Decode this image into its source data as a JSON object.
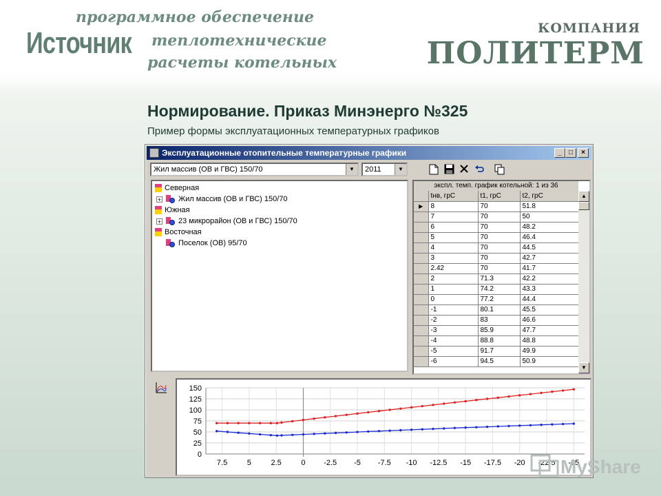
{
  "header": {
    "logo": "Источник",
    "tagline_1": "программное обеспечение",
    "tagline_2": "теплотехнические",
    "tagline_3": "расчеты котельных",
    "company_label": "КОМПАНИЯ",
    "company_name": "ПОЛИТЕРМ"
  },
  "slide": {
    "title": "Нормирование. Приказ Минэнерго №325",
    "subtitle": "Пример формы эксплуатационных температурных графиков"
  },
  "window": {
    "title": "Эксплуатационные отопительные температурные графики",
    "combo_schedule": "Жил массив (ОВ и ГВС) 150/70",
    "combo_year": "2011",
    "toolbar_icons": [
      "new-icon",
      "save-icon",
      "delete-icon",
      "undo-icon",
      "copy-icon"
    ]
  },
  "tree": {
    "nodes": [
      {
        "label": "Северная",
        "kind": "group",
        "level": 0
      },
      {
        "label": "Жил массив (ОВ и ГВС) 150/70",
        "kind": "object",
        "level": 1,
        "expandable": true
      },
      {
        "label": "Южная",
        "kind": "group",
        "level": 0
      },
      {
        "label": "23 микрорайон (ОВ и ГВС) 150/70",
        "kind": "object",
        "level": 1,
        "expandable": true
      },
      {
        "label": "Восточная",
        "kind": "group",
        "level": 0
      },
      {
        "label": "Поселок (ОВ) 95/70",
        "kind": "object",
        "level": 1,
        "expandable": false
      }
    ]
  },
  "grid": {
    "caption": "экспл. темп. график котельной: 1 из 36",
    "columns": [
      "tнв, грС",
      "t1, грС",
      "t2, грС"
    ],
    "rows": [
      [
        "8",
        "70",
        "51.8"
      ],
      [
        "7",
        "70",
        "50"
      ],
      [
        "6",
        "70",
        "48.2"
      ],
      [
        "5",
        "70",
        "46.4"
      ],
      [
        "4",
        "70",
        "44.5"
      ],
      [
        "3",
        "70",
        "42.7"
      ],
      [
        "2.42",
        "70",
        "41.7"
      ],
      [
        "2",
        "71.3",
        "42.2"
      ],
      [
        "1",
        "74.2",
        "43.3"
      ],
      [
        "0",
        "77.2",
        "44.4"
      ],
      [
        "-1",
        "80.1",
        "45.5"
      ],
      [
        "-2",
        "83",
        "46.6"
      ],
      [
        "-3",
        "85.9",
        "47.7"
      ],
      [
        "-4",
        "88.8",
        "48.8"
      ],
      [
        "-5",
        "91.7",
        "49.9"
      ],
      [
        "-6",
        "94.5",
        "50.9"
      ]
    ]
  },
  "chart_data": {
    "type": "line",
    "xlim": [
      9,
      -26
    ],
    "ylim": [
      0,
      150
    ],
    "x_ticks": [
      "7.5",
      "5",
      "2.5",
      "0",
      "-2.5",
      "-5",
      "-7.5",
      "-10",
      "-12.5",
      "-15",
      "-17.5",
      "-20",
      "-22.5",
      "-25"
    ],
    "y_ticks": [
      "150",
      "125",
      "100",
      "75",
      "50",
      "25",
      "0"
    ],
    "grid": true,
    "colors": {
      "t1": "#e02020",
      "t2": "#1a2ad0",
      "cursor": "#808080"
    },
    "cursor_x": 0,
    "x": [
      8,
      7,
      6,
      5,
      4,
      3,
      2.42,
      2,
      1,
      0,
      -1,
      -2,
      -3,
      -4,
      -5,
      -6,
      -7,
      -8,
      -9,
      -10,
      -11,
      -12,
      -13,
      -14,
      -15,
      -16,
      -17,
      -18,
      -19,
      -20,
      -21,
      -22,
      -23,
      -24,
      -25
    ],
    "series": [
      {
        "key": "t1",
        "values": [
          70,
          70,
          70,
          70,
          70,
          70,
          70,
          71.3,
          74.2,
          77.2,
          80.1,
          83,
          85.9,
          88.8,
          91.7,
          94.5,
          97.3,
          100.1,
          102.9,
          105.7,
          108.5,
          111.3,
          114.1,
          116.9,
          119.6,
          122.3,
          125.0,
          127.7,
          130.4,
          133.1,
          135.8,
          138.5,
          141.2,
          143.9,
          146.6
        ]
      },
      {
        "key": "t2",
        "values": [
          51.8,
          50,
          48.2,
          46.4,
          44.5,
          42.7,
          41.7,
          42.2,
          43.3,
          44.4,
          45.5,
          46.6,
          47.7,
          48.8,
          49.9,
          50.9,
          51.9,
          52.9,
          53.9,
          54.9,
          55.9,
          56.9,
          57.9,
          58.9,
          59.8,
          60.7,
          61.6,
          62.5,
          63.4,
          64.3,
          65.2,
          66.1,
          67.0,
          67.9,
          68.8
        ]
      }
    ]
  }
}
